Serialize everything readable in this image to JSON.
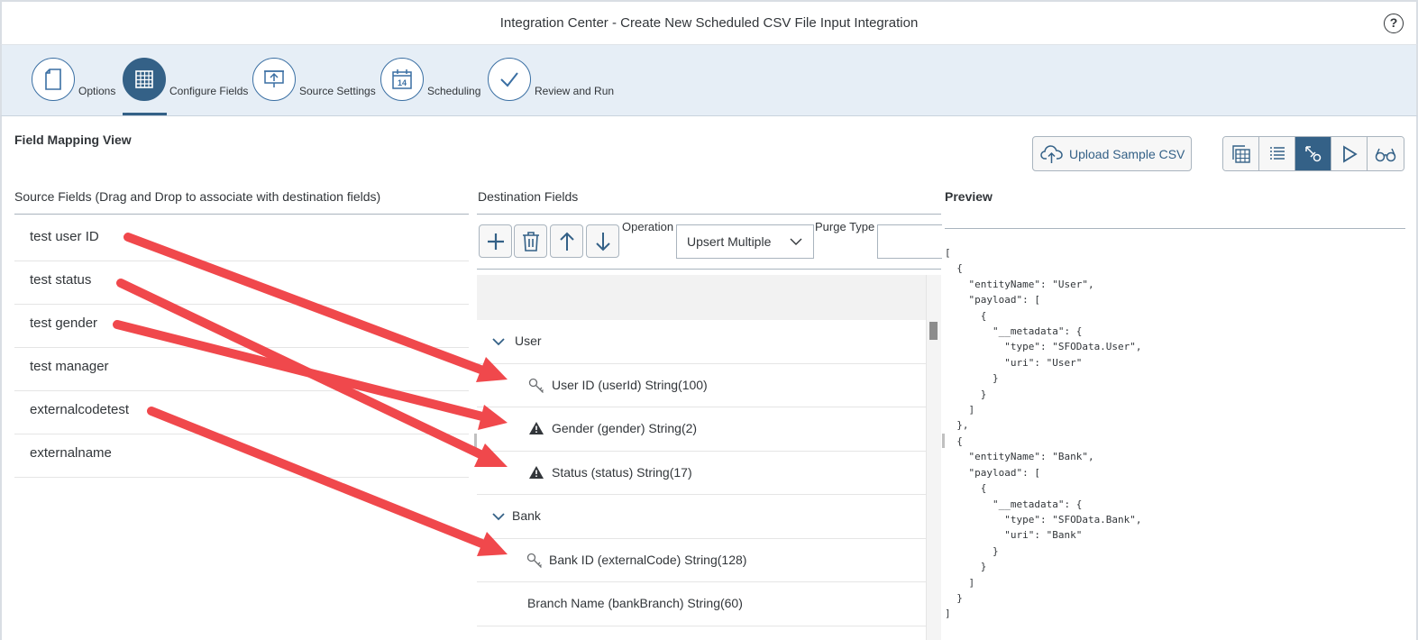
{
  "window": {
    "title": "Integration Center - Create New Scheduled CSV File Input Integration"
  },
  "wizard": {
    "steps": [
      {
        "label": "Options",
        "icon": "page-icon"
      },
      {
        "label": "Configure Fields",
        "icon": "grid-icon",
        "active": true
      },
      {
        "label": "Source Settings",
        "icon": "presentation-icon"
      },
      {
        "label": "Scheduling",
        "icon": "calendar-icon",
        "calendar_day": "14"
      },
      {
        "label": "Review and Run",
        "icon": "checkmark-icon"
      }
    ]
  },
  "view": {
    "title": "Field Mapping View",
    "upload_label": "Upload Sample CSV"
  },
  "source": {
    "header": "Source Fields (Drag and Drop to associate with destination fields)",
    "fields": [
      "test user ID",
      "test status",
      "test gender",
      "test manager",
      "externalcodetest",
      "externalname"
    ]
  },
  "destination": {
    "header": "Destination Fields",
    "operation_label": "Operation",
    "operation_value": "Upsert Multiple",
    "purge_label": "Purge Type",
    "rows": [
      {
        "kind": "group",
        "label": "User"
      },
      {
        "kind": "field",
        "icon": "key-icon",
        "label": "User ID (userId) String(100)"
      },
      {
        "kind": "field",
        "icon": "warning-icon",
        "label": "Gender (gender) String(2)"
      },
      {
        "kind": "field",
        "icon": "warning-icon",
        "label": "Status (status) String(17)"
      },
      {
        "kind": "group",
        "label": "Bank"
      },
      {
        "kind": "field",
        "icon": "key-icon",
        "label": "Bank ID (externalCode) String(128)"
      },
      {
        "kind": "field",
        "icon": "",
        "label": "Branch Name (bankBranch) String(60)"
      }
    ]
  },
  "preview": {
    "header": "Preview",
    "json_text": "[\n  {\n    \"entityName\": \"User\",\n    \"payload\": [\n      {\n        \"__metadata\": {\n          \"type\": \"SFOData.User\",\n          \"uri\": \"User\"\n        }\n      }\n    ]\n  },\n  {\n    \"entityName\": \"Bank\",\n    \"payload\": [\n      {\n        \"__metadata\": {\n          \"type\": \"SFOData.Bank\",\n          \"uri\": \"Bank\"\n        }\n      }\n    ]\n  }\n]"
  },
  "colors": {
    "accent": "#346187",
    "arrow": "#f0484c",
    "step_bar": "#e6eef6"
  }
}
